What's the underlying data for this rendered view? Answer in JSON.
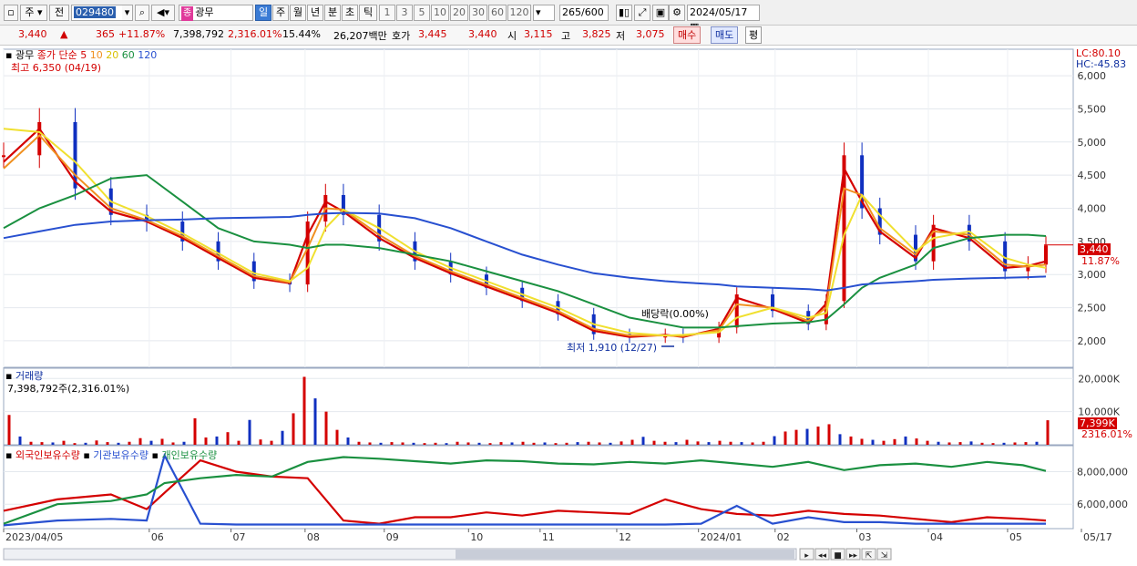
{
  "toolbar": {
    "mode": "주",
    "prev": "전",
    "code": "029480",
    "stock_badge": "종",
    "stock_name": "광무",
    "periods": [
      "일",
      "주",
      "월",
      "년",
      "분",
      "초",
      "틱"
    ],
    "active_period": "일",
    "intervals": [
      "1",
      "3",
      "5",
      "10",
      "20",
      "30",
      "60",
      "120"
    ],
    "count": "265",
    "count_total": "/600",
    "date": "2024/05/17"
  },
  "infobar": {
    "price": "3,440",
    "up_mark": "▲",
    "change": "365",
    "change_pct": "+11.87%",
    "volume": "7,398,792",
    "volume_pct": "2,316.01%",
    "turnover": "15.44%",
    "amount": "26,207백만",
    "ask_label": "호가",
    "ask1": "3,445",
    "ask2": "3,440",
    "open_label": "시",
    "open": "3,115",
    "high_label": "고",
    "high": "3,825",
    "low_label": "저",
    "low": "3,075",
    "buy": "매수",
    "sell": "매도",
    "eval": "평"
  },
  "price_panel": {
    "name": "광무",
    "ma_label": "종가 단순",
    "ma_periods": [
      "5",
      "10",
      "20",
      "60",
      "120"
    ],
    "ma_colors": [
      "#d40000",
      "#f09020",
      "#f0e030",
      "#1a9040",
      "#2850d0"
    ],
    "high_note": "최고 6,350 (04/19)",
    "low_note": "최저 1,910 (12/27)",
    "dividend_note": "배당락(0.00%)",
    "lc": "LC:80.10",
    "hc": "HC:-45.83",
    "current_price": "3,440",
    "current_pct": "11.87%"
  },
  "volume_panel": {
    "title": "거래량",
    "value": "7,398,792주(2,316.01%)",
    "current": "7,399K",
    "current_pct": "2316.01%"
  },
  "holding_panel": {
    "series": [
      "외국인보유수량",
      "기관보유수량",
      "개인보유수량"
    ],
    "series_colors": [
      "#d40000",
      "#2850d0",
      "#1a9040"
    ]
  },
  "x_axis": [
    "2023/04/05",
    "06",
    "07",
    "08",
    "09",
    "10",
    "11",
    "12",
    "2024/01",
    "02",
    "03",
    "04",
    "05",
    "05/17"
  ],
  "chart_data": [
    {
      "type": "candlestick",
      "title": "광무",
      "ylim": [
        1600,
        6400
      ],
      "y_ticks": [
        2000,
        2500,
        3000,
        3500,
        4000,
        4500,
        5000,
        5500,
        6000
      ],
      "x": [
        "2023-04-05",
        "2023-04-19",
        "2023-05-03",
        "2023-05-17",
        "2023-05-31",
        "2023-06-14",
        "2023-06-28",
        "2023-07-12",
        "2023-07-26",
        "2023-08-02",
        "2023-08-09",
        "2023-08-16",
        "2023-08-30",
        "2023-09-13",
        "2023-09-27",
        "2023-10-11",
        "2023-10-25",
        "2023-11-08",
        "2023-11-22",
        "2023-12-06",
        "2023-12-20",
        "2023-12-27",
        "2024-01-10",
        "2024-01-17",
        "2024-01-31",
        "2024-02-14",
        "2024-02-21",
        "2024-02-28",
        "2024-03-06",
        "2024-03-13",
        "2024-03-27",
        "2024-04-03",
        "2024-04-17",
        "2024-05-01",
        "2024-05-10",
        "2024-05-17"
      ],
      "close": [
        4800,
        5300,
        4300,
        3900,
        3800,
        3500,
        3200,
        2900,
        2850,
        3800,
        4200,
        3900,
        3500,
        3200,
        3000,
        2800,
        2600,
        2400,
        2100,
        2050,
        2100,
        2050,
        2200,
        2700,
        2450,
        2250,
        2600,
        4800,
        4000,
        3600,
        3200,
        3750,
        3500,
        3050,
        3150,
        3440
      ],
      "series": [
        {
          "name": "5",
          "values": [
            4700,
            5200,
            4400,
            3950,
            3800,
            3550,
            3250,
            2950,
            2870,
            3600,
            4100,
            3950,
            3550,
            3250,
            3020,
            2820,
            2620,
            2420,
            2150,
            2060,
            2090,
            2060,
            2180,
            2650,
            2480,
            2270,
            2560,
            4600,
            4100,
            3650,
            3250,
            3700,
            3550,
            3100,
            3130,
            3200
          ]
        },
        {
          "name": "10",
          "values": [
            4600,
            5100,
            4500,
            4000,
            3820,
            3580,
            3280,
            2980,
            2880,
            3400,
            4000,
            3980,
            3600,
            3280,
            3050,
            2850,
            2650,
            2450,
            2180,
            2080,
            2080,
            2070,
            2160,
            2550,
            2500,
            2300,
            2500,
            4300,
            4200,
            3700,
            3300,
            3650,
            3600,
            3150,
            3120,
            3150
          ]
        },
        {
          "name": "20",
          "values": [
            5200,
            5150,
            4700,
            4100,
            3880,
            3620,
            3320,
            3020,
            2900,
            3100,
            3700,
            3980,
            3700,
            3350,
            3100,
            2900,
            2700,
            2500,
            2250,
            2120,
            2080,
            2090,
            2130,
            2350,
            2500,
            2350,
            2420,
            3600,
            4200,
            3900,
            3350,
            3550,
            3650,
            3250,
            3150,
            3100
          ]
        },
        {
          "name": "60",
          "values": [
            3700,
            4000,
            4200,
            4450,
            4500,
            4100,
            3700,
            3500,
            3450,
            3400,
            3450,
            3450,
            3400,
            3300,
            3200,
            3050,
            2900,
            2750,
            2550,
            2350,
            2250,
            2200,
            2200,
            2220,
            2260,
            2280,
            2320,
            2550,
            2800,
            2950,
            3150,
            3400,
            3550,
            3600,
            3600,
            3580
          ]
        },
        {
          "name": "120",
          "values": [
            3550,
            3650,
            3750,
            3800,
            3820,
            3830,
            3850,
            3860,
            3870,
            3900,
            3920,
            3930,
            3920,
            3850,
            3700,
            3500,
            3300,
            3150,
            3020,
            2950,
            2900,
            2880,
            2850,
            2820,
            2800,
            2780,
            2760,
            2800,
            2850,
            2870,
            2900,
            2920,
            2940,
            2950,
            2960,
            2970
          ]
        }
      ]
    },
    {
      "type": "bar",
      "title": "거래량",
      "ylim": [
        0,
        22000
      ],
      "y_ticks": [
        10000,
        20000
      ],
      "unit": "K",
      "values": [
        9000,
        2500,
        900,
        800,
        700,
        1200,
        500,
        600,
        1300,
        800,
        600,
        900,
        2000,
        1200,
        1800,
        700,
        900,
        8000,
        2200,
        2500,
        3800,
        1200,
        7500,
        1600,
        1200,
        4200,
        9500,
        20500,
        14000,
        10000,
        4500,
        2200,
        900,
        700,
        600,
        800,
        700,
        600,
        500,
        600,
        500,
        900,
        700,
        600,
        500,
        800,
        700,
        900,
        600,
        700,
        500,
        600,
        800,
        900,
        700,
        600,
        1000,
        1500,
        2400,
        1200,
        900,
        800,
        1500,
        1000,
        800,
        1200,
        900,
        800,
        700,
        900,
        2600,
        4000,
        4500,
        4800,
        5500,
        6200,
        3200,
        2500,
        1800,
        1500,
        1200,
        1700,
        2500,
        1900,
        1200,
        900,
        700,
        800,
        1000,
        600,
        500,
        600,
        700,
        800,
        900,
        7399
      ]
    },
    {
      "type": "line",
      "title": "보유수량",
      "ylim": [
        4500000,
        9600000
      ],
      "y_ticks": [
        6000000,
        8000000
      ],
      "x": [
        "2023-04-05",
        "2023-04-26",
        "2023-05-17",
        "2023-05-31",
        "2023-06-07",
        "2023-06-21",
        "2023-07-05",
        "2023-07-19",
        "2023-08-02",
        "2023-08-16",
        "2023-08-30",
        "2023-09-13",
        "2023-09-27",
        "2023-10-11",
        "2023-10-25",
        "2023-11-08",
        "2023-11-22",
        "2023-12-06",
        "2023-12-20",
        "2024-01-03",
        "2024-01-17",
        "2024-01-31",
        "2024-02-14",
        "2024-02-28",
        "2024-03-13",
        "2024-03-27",
        "2024-04-10",
        "2024-04-24",
        "2024-05-08",
        "2024-05-17"
      ],
      "series": [
        {
          "name": "외국인보유수량",
          "values": [
            5600000,
            6300000,
            6600000,
            5700000,
            6700000,
            8700000,
            8000000,
            7700000,
            7600000,
            5000000,
            4800000,
            5200000,
            5200000,
            5500000,
            5300000,
            5600000,
            5500000,
            5400000,
            6300000,
            5700000,
            5400000,
            5300000,
            5600000,
            5400000,
            5300000,
            5100000,
            4900000,
            5200000,
            5100000,
            5000000
          ]
        },
        {
          "name": "기관보유수량",
          "values": [
            4700000,
            5000000,
            5100000,
            5000000,
            9000000,
            4800000,
            4750000,
            4750000,
            4750000,
            4750000,
            4750000,
            4750000,
            4750000,
            4750000,
            4750000,
            4750000,
            4750000,
            4750000,
            4750000,
            4800000,
            5900000,
            4800000,
            5200000,
            4900000,
            4900000,
            4800000,
            4800000,
            4800000,
            4800000,
            4800000
          ]
        },
        {
          "name": "개인보유수량",
          "values": [
            4800000,
            6000000,
            6200000,
            6600000,
            7300000,
            7600000,
            7800000,
            7700000,
            8600000,
            8900000,
            8800000,
            8650000,
            8500000,
            8700000,
            8650000,
            8500000,
            8450000,
            8600000,
            8500000,
            8700000,
            8500000,
            8300000,
            8600000,
            8100000,
            8400000,
            8500000,
            8300000,
            8600000,
            8400000,
            8050000
          ]
        }
      ]
    }
  ]
}
